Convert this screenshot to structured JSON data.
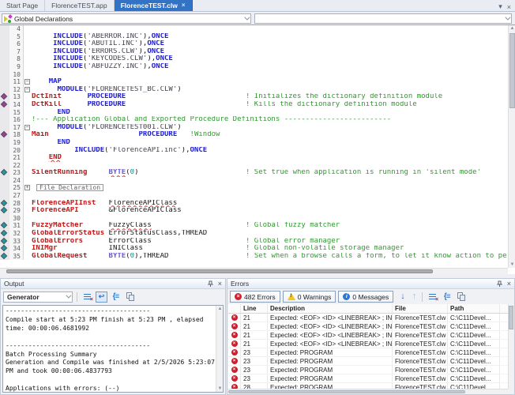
{
  "tabs": [
    {
      "label": "Start Page",
      "active": false
    },
    {
      "label": "FlorenceTEST.app",
      "active": false
    },
    {
      "label": "FlorenceTEST.clw",
      "active": true,
      "close_glyph": "×"
    }
  ],
  "window_controls": {
    "dropdown_glyph": "▾",
    "close_glyph": "×"
  },
  "navbar": {
    "scope_selector": "Global Declarations",
    "member_selector": ""
  },
  "colors": {
    "active_tab": "#3273C5",
    "keyword": "#1A1AD4",
    "identifier": "#C21717",
    "comment": "#2E9A2E",
    "type": "#6A5ACD",
    "error_red": "#C9202E",
    "bookmark_purple": "#A23AA2",
    "bookmark_teal": "#1B9AA8"
  },
  "editor": {
    "lines": [
      {
        "n": "4",
        "seg": []
      },
      {
        "n": "5",
        "seg": [
          [
            "p",
            "     "
          ],
          [
            "k",
            "INCLUDE"
          ],
          [
            "p",
            "("
          ],
          [
            "s",
            "'ABERROR.INC'"
          ],
          [
            "p",
            "),"
          ],
          [
            "k",
            "ONCE"
          ]
        ]
      },
      {
        "n": "6",
        "seg": [
          [
            "p",
            "     "
          ],
          [
            "k",
            "INCLUDE"
          ],
          [
            "p",
            "("
          ],
          [
            "s",
            "'ABUTIL.INC'"
          ],
          [
            "p",
            "),"
          ],
          [
            "k",
            "ONCE"
          ]
        ]
      },
      {
        "n": "7",
        "seg": [
          [
            "p",
            "     "
          ],
          [
            "k",
            "INCLUDE"
          ],
          [
            "p",
            "("
          ],
          [
            "s",
            "'ERRORS.CLW'"
          ],
          [
            "p",
            "),"
          ],
          [
            "k",
            "ONCE"
          ]
        ]
      },
      {
        "n": "8",
        "seg": [
          [
            "p",
            "     "
          ],
          [
            "k",
            "INCLUDE"
          ],
          [
            "p",
            "("
          ],
          [
            "s",
            "'KEYCODES.CLW'"
          ],
          [
            "p",
            "),"
          ],
          [
            "k",
            "ONCE"
          ]
        ]
      },
      {
        "n": "9",
        "seg": [
          [
            "p",
            "     "
          ],
          [
            "k",
            "INCLUDE"
          ],
          [
            "p",
            "("
          ],
          [
            "s",
            "'ABFUZZY.INC'"
          ],
          [
            "p",
            "),"
          ],
          [
            "k",
            "ONCE"
          ]
        ]
      },
      {
        "n": "10",
        "seg": []
      },
      {
        "n": "11",
        "fold": "minus",
        "seg": [
          [
            "p",
            "    "
          ],
          [
            "k",
            "MAP"
          ]
        ]
      },
      {
        "n": "12",
        "fold": "minus",
        "seg": [
          [
            "p",
            "      "
          ],
          [
            "k",
            "MODULE"
          ],
          [
            "p",
            "("
          ],
          [
            "s",
            "'FLORENCETEST_BC.CLW'"
          ],
          [
            "p",
            ")"
          ]
        ]
      },
      {
        "n": "13",
        "bm": "purple",
        "seg": [
          [
            "i",
            "DctInit"
          ],
          [
            "p",
            "      "
          ],
          [
            "k",
            "PROCEDURE"
          ],
          [
            "p",
            "                            "
          ],
          [
            "c",
            "! Initializes the dictionary definition module"
          ]
        ]
      },
      {
        "n": "14",
        "bm": "purple",
        "seg": [
          [
            "i",
            "DctKill"
          ],
          [
            "p",
            "      "
          ],
          [
            "k",
            "PROCEDURE"
          ],
          [
            "p",
            "                            "
          ],
          [
            "c",
            "! Kills the dictionary definition module"
          ]
        ]
      },
      {
        "n": "15",
        "seg": [
          [
            "p",
            "      "
          ],
          [
            "k",
            "END"
          ]
        ]
      },
      {
        "n": "16",
        "seg": [
          [
            "c",
            "!--- Application Global and Exported Procedure Definitions -------------------------"
          ]
        ]
      },
      {
        "n": "17",
        "fold": "minus",
        "seg": [
          [
            "p",
            "      "
          ],
          [
            "k",
            "MODULE"
          ],
          [
            "p",
            "("
          ],
          [
            "s",
            "'FLORENCETEST001.CLW'"
          ],
          [
            "p",
            ")"
          ]
        ]
      },
      {
        "n": "18",
        "bm": "purple",
        "seg": [
          [
            "i",
            "Main"
          ],
          [
            "p",
            "                     "
          ],
          [
            "k",
            "PROCEDURE"
          ],
          [
            "p",
            "   "
          ],
          [
            "c",
            "!Window"
          ]
        ]
      },
      {
        "n": "19",
        "seg": [
          [
            "p",
            "      "
          ],
          [
            "k",
            "END"
          ]
        ]
      },
      {
        "n": "20",
        "seg": [
          [
            "p",
            "          "
          ],
          [
            "k",
            "INCLUDE"
          ],
          [
            "p",
            "("
          ],
          [
            "s",
            "'FlorenceAPI.inc'"
          ],
          [
            "p",
            "),"
          ],
          [
            "k",
            "ONCE"
          ]
        ]
      },
      {
        "n": "21",
        "seg": [
          [
            "p",
            "    "
          ],
          [
            "e sq",
            "END"
          ]
        ]
      },
      {
        "n": "22",
        "seg": []
      },
      {
        "n": "23",
        "bm": "teal",
        "seg": [
          [
            "i",
            "SilentRunning"
          ],
          [
            "p",
            "     "
          ],
          [
            "t sq",
            "BYTE"
          ],
          [
            "p",
            "("
          ],
          [
            "n",
            "0"
          ],
          [
            "p",
            ")"
          ],
          [
            "p",
            "                         "
          ],
          [
            "c",
            "! Set true when application is running in 'silent mode'"
          ]
        ]
      },
      {
        "n": "24",
        "seg": []
      },
      {
        "n": "25",
        "fold": "plus",
        "seg": [
          [
            "f",
            "File Declaration"
          ]
        ]
      },
      {
        "n": "27",
        "seg": []
      },
      {
        "n": "28",
        "bm": "teal",
        "seg": [
          [
            "i",
            "FlorenceAPIInst"
          ],
          [
            "p",
            "   "
          ],
          [
            "p sq",
            "FlorenceAPIClass"
          ]
        ]
      },
      {
        "n": "29",
        "bm": "teal",
        "seg": [
          [
            "i",
            "FlorenceAPI"
          ],
          [
            "p",
            "       "
          ],
          [
            "p",
            "&FlorenceAPIClass"
          ]
        ]
      },
      {
        "n": "30",
        "seg": []
      },
      {
        "n": "31",
        "bm": "teal",
        "seg": [
          [
            "i",
            "FuzzyMatcher"
          ],
          [
            "p",
            "      "
          ],
          [
            "p sq",
            "FuzzyClass"
          ],
          [
            "p",
            "                      "
          ],
          [
            "c",
            "! Global fuzzy matcher"
          ]
        ]
      },
      {
        "n": "32",
        "bm": "teal",
        "seg": [
          [
            "i",
            "GlobalErrorStatus"
          ],
          [
            "p",
            " "
          ],
          [
            "p",
            "ErrorStatusClass,THREAD"
          ]
        ]
      },
      {
        "n": "33",
        "bm": "teal",
        "seg": [
          [
            "i",
            "GlobalErrors"
          ],
          [
            "p",
            "      "
          ],
          [
            "p",
            "ErrorClass"
          ],
          [
            "p",
            "                      "
          ],
          [
            "c",
            "! Global error manager"
          ]
        ]
      },
      {
        "n": "34",
        "bm": "teal",
        "seg": [
          [
            "i",
            "INIMgr"
          ],
          [
            "p",
            "            "
          ],
          [
            "p",
            "INIClass"
          ],
          [
            "p",
            "                        "
          ],
          [
            "c",
            "! Global non-volatile storage manager"
          ]
        ]
      },
      {
        "n": "35",
        "bm": "teal",
        "seg": [
          [
            "i",
            "GlobalRequest"
          ],
          [
            "p",
            "     "
          ],
          [
            "t",
            "BYTE"
          ],
          [
            "p",
            "("
          ],
          [
            "n",
            "0"
          ],
          [
            "p",
            ")"
          ],
          [
            "p",
            ",THREAD"
          ],
          [
            "p",
            "                  "
          ],
          [
            "c",
            "! Set when a browse calls a form, to let it know action to perform"
          ]
        ]
      }
    ]
  },
  "output": {
    "title": "Output",
    "generator_label": "Generator",
    "lines": [
      "--------------------------------------",
      "Compile start at 5:23 PM finish at 5:23 PM , elapsed",
      "time: 00:00:06.4681992",
      "",
      "--------------------------------------",
      "Batch Processing Summary",
      "Generation and Compile was finished at 2/5/2026 5:23:07",
      "PM and took 00:00:06.4837793",
      "",
      "Applications with errors: (--)"
    ]
  },
  "errors": {
    "title": "Errors",
    "errors_label": "482 Errors",
    "warnings_label": "0 Warnings",
    "messages_label": "0 Messages",
    "columns": [
      "Line",
      "Description",
      "File",
      "Path"
    ],
    "rows": [
      {
        "line": "21",
        "description": "Expected: <EOF> <ID> <LINEBREAK> ; INCLUDE OMI...",
        "file": "FlorenceTEST.clw",
        "path": "C:\\C11Devel..."
      },
      {
        "line": "21",
        "description": "Expected: <EOF> <ID> <LINEBREAK> ; INCLUDE OMI...",
        "file": "FlorenceTEST.clw",
        "path": "C:\\C11Devel..."
      },
      {
        "line": "21",
        "description": "Expected: <EOF> <ID> <LINEBREAK> ; INCLUDE OMI...",
        "file": "FlorenceTEST.clw",
        "path": "C:\\C11Devel..."
      },
      {
        "line": "21",
        "description": "Expected: <EOF> <ID> <LINEBREAK> ; INCLUDE OMI...",
        "file": "FlorenceTEST.clw",
        "path": "C:\\C11Devel..."
      },
      {
        "line": "23",
        "description": "Expected: PROGRAM",
        "file": "FlorenceTEST.clw",
        "path": "C:\\C11Devel..."
      },
      {
        "line": "23",
        "description": "Expected: PROGRAM",
        "file": "FlorenceTEST.clw",
        "path": "C:\\C11Devel..."
      },
      {
        "line": "23",
        "description": "Expected: PROGRAM",
        "file": "FlorenceTEST.clw",
        "path": "C:\\C11Devel..."
      },
      {
        "line": "23",
        "description": "Expected: PROGRAM",
        "file": "FlorenceTEST.clw",
        "path": "C:\\C11Devel..."
      },
      {
        "line": "28",
        "description": "Expected: PROGRAM",
        "file": "FlorenceTEST.clw",
        "path": "C:\\C11Devel..."
      }
    ]
  }
}
